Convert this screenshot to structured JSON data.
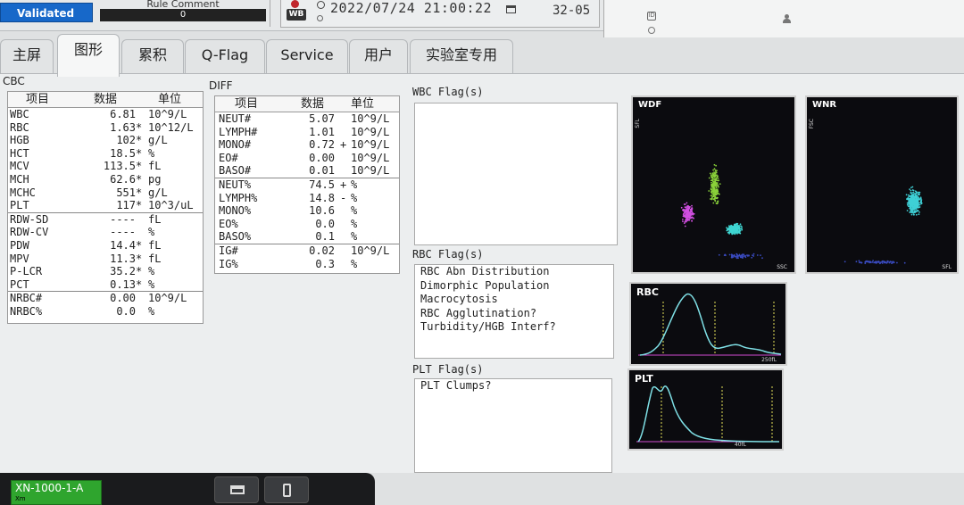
{
  "status": {
    "validated": "Validated",
    "rule_comment_label": "Rule Comment",
    "rule_comment_value": "0"
  },
  "sample": {
    "type_badge": "WB",
    "datetime": "2022/07/24 21:00:22",
    "rack_position": "32-05"
  },
  "patient": {
    "id_icon": "ID"
  },
  "tabs": [
    {
      "label": "主屏"
    },
    {
      "label": "图形"
    },
    {
      "label": "累积"
    },
    {
      "label": "Q-Flag"
    },
    {
      "label": "Service"
    },
    {
      "label": "用户"
    },
    {
      "label": "实验室专用"
    }
  ],
  "cbc": {
    "title": "CBC",
    "headers": {
      "item": "项目",
      "data": "数据",
      "unit": "单位"
    },
    "rows": [
      {
        "name": "WBC",
        "value": "6.81",
        "mark": "",
        "unit": "10^9/L"
      },
      {
        "name": "RBC",
        "value": "1.63",
        "mark": "*",
        "unit": "10^12/L"
      },
      {
        "name": "HGB",
        "value": "102",
        "mark": "*",
        "unit": "g/L"
      },
      {
        "name": "HCT",
        "value": "18.5",
        "mark": "*",
        "unit": "%"
      },
      {
        "name": "MCV",
        "value": "113.5",
        "mark": "*",
        "unit": "fL"
      },
      {
        "name": "MCH",
        "value": "62.6",
        "mark": "*",
        "unit": "pg"
      },
      {
        "name": "MCHC",
        "value": "551",
        "mark": "*",
        "unit": "g/L"
      },
      {
        "name": "PLT",
        "value": "117",
        "mark": "*",
        "unit": "10^3/uL"
      },
      {
        "name": "RDW-SD",
        "value": "----",
        "mark": "",
        "unit": "fL"
      },
      {
        "name": "RDW-CV",
        "value": "----",
        "mark": "",
        "unit": "%"
      },
      {
        "name": "PDW",
        "value": "14.4",
        "mark": "*",
        "unit": "fL"
      },
      {
        "name": "MPV",
        "value": "11.3",
        "mark": "*",
        "unit": "fL"
      },
      {
        "name": "P-LCR",
        "value": "35.2",
        "mark": "*",
        "unit": "%"
      },
      {
        "name": "PCT",
        "value": "0.13",
        "mark": "*",
        "unit": "%"
      },
      {
        "name": "NRBC#",
        "value": "0.00",
        "mark": "",
        "unit": "10^9/L"
      },
      {
        "name": "NRBC%",
        "value": "0.0",
        "mark": "",
        "unit": "%"
      }
    ]
  },
  "diff": {
    "title": "DIFF",
    "headers": {
      "item": "项目",
      "data": "数据",
      "unit": "单位"
    },
    "rows": [
      {
        "name": "NEUT#",
        "value": "5.07",
        "mark": "",
        "unit": "10^9/L"
      },
      {
        "name": "LYMPH#",
        "value": "1.01",
        "mark": "",
        "unit": "10^9/L"
      },
      {
        "name": "MONO#",
        "value": "0.72",
        "mark": "+",
        "unit": "10^9/L"
      },
      {
        "name": "EO#",
        "value": "0.00",
        "mark": "",
        "unit": "10^9/L"
      },
      {
        "name": "BASO#",
        "value": "0.01",
        "mark": "",
        "unit": "10^9/L"
      },
      {
        "name": "NEUT%",
        "value": "74.5",
        "mark": "+",
        "unit": "%"
      },
      {
        "name": "LYMPH%",
        "value": "14.8",
        "mark": "-",
        "unit": "%"
      },
      {
        "name": "MONO%",
        "value": "10.6",
        "mark": "",
        "unit": "%"
      },
      {
        "name": "EO%",
        "value": "0.0",
        "mark": "",
        "unit": "%"
      },
      {
        "name": "BASO%",
        "value": "0.1",
        "mark": "",
        "unit": "%"
      },
      {
        "name": "IG#",
        "value": "0.02",
        "mark": "",
        "unit": "10^9/L"
      },
      {
        "name": "IG%",
        "value": "0.3",
        "mark": "",
        "unit": "%"
      }
    ]
  },
  "flags": {
    "wbc_title": "WBC Flag(s)",
    "wbc": [],
    "rbc_title": "RBC Flag(s)",
    "rbc": [
      "RBC Abn Distribution",
      "Dimorphic Population",
      "Macrocytosis",
      "RBC Agglutination?",
      "Turbidity/HGB Interf?"
    ],
    "plt_title": "PLT Flag(s)",
    "plt": [
      "PLT Clumps?"
    ]
  },
  "plots": {
    "wdf_title": "WDF",
    "wdf_y": "SFL",
    "wdf_x": "SSC",
    "wnr_title": "WNR",
    "wnr_y": "FSC",
    "wnr_x": "SFL",
    "rbc_title": "RBC",
    "rbc_axis": "250fL",
    "plt_title": "PLT",
    "plt_axis": "40fL",
    "colors": {
      "neut": "#8ad23a",
      "lymph": "#d04fe0",
      "mono": "#3fd6d2",
      "wnr": "#3fd0d6",
      "curve": "#7fe0e6",
      "marker": "#e6e05a",
      "axis": "#d14bd1"
    }
  },
  "bottom": {
    "analyzer": "XN-1000-1-A",
    "analyzer_mini": "Xm"
  }
}
